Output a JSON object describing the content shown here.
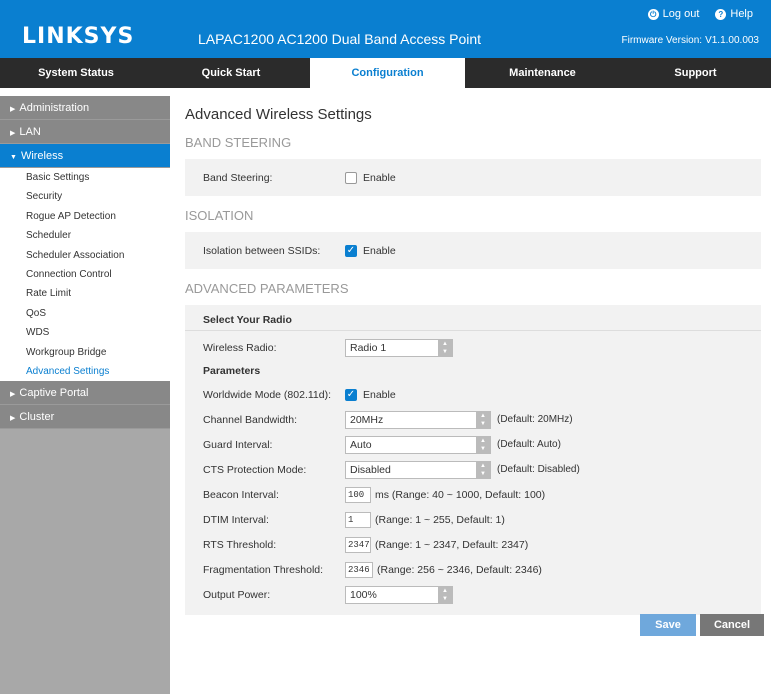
{
  "header": {
    "logo": "LINKSYS",
    "product": "LAPAC1200 AC1200 Dual Band Access Point",
    "logout": "Log out",
    "help": "Help",
    "firmware_label": "Firmware Version:",
    "firmware_value": "V1.1.00.003"
  },
  "nav": {
    "tabs": [
      "System Status",
      "Quick Start",
      "Configuration",
      "Maintenance",
      "Support"
    ],
    "active": "Configuration"
  },
  "sidebar": {
    "groups": [
      "Administration",
      "LAN",
      "Wireless",
      "Captive Portal",
      "Cluster"
    ],
    "wireless_items": [
      "Basic Settings",
      "Security",
      "Rogue AP Detection",
      "Scheduler",
      "Scheduler Association",
      "Connection Control",
      "Rate Limit",
      "QoS",
      "WDS",
      "Workgroup Bridge",
      "Advanced Settings"
    ]
  },
  "main": {
    "title": "Advanced Wireless Settings",
    "band_steering": {
      "section": "BAND STEERING",
      "label": "Band Steering:",
      "enable": "Enable",
      "checked": false
    },
    "isolation": {
      "section": "ISOLATION",
      "label": "Isolation between SSIDs:",
      "enable": "Enable",
      "checked": true
    },
    "advanced": {
      "section": "ADVANCED PARAMETERS",
      "select_radio": "Select Your Radio",
      "wireless_radio_label": "Wireless Radio:",
      "wireless_radio_value": "Radio 1",
      "parameters": "Parameters",
      "worldwide_label": "Worldwide Mode (802.11d):",
      "worldwide_enable": "Enable",
      "worldwide_checked": true,
      "channel_bw_label": "Channel Bandwidth:",
      "channel_bw_value": "20MHz",
      "channel_bw_hint": "(Default: 20MHz)",
      "guard_label": "Guard Interval:",
      "guard_value": "Auto",
      "guard_hint": "(Default: Auto)",
      "cts_label": "CTS Protection Mode:",
      "cts_value": "Disabled",
      "cts_hint": "(Default: Disabled)",
      "beacon_label": "Beacon Interval:",
      "beacon_value": "100",
      "beacon_hint": "ms (Range: 40 ~ 1000, Default: 100)",
      "dtim_label": "DTIM Interval:",
      "dtim_value": "1",
      "dtim_hint": "(Range: 1 ~ 255, Default: 1)",
      "rts_label": "RTS Threshold:",
      "rts_value": "2347",
      "rts_hint": "(Range: 1 ~ 2347, Default: 2347)",
      "frag_label": "Fragmentation Threshold:",
      "frag_value": "2346",
      "frag_hint": "(Range: 256 ~ 2346, Default: 2346)",
      "output_label": "Output Power:",
      "output_value": "100%"
    }
  },
  "actions": {
    "save": "Save",
    "cancel": "Cancel"
  }
}
